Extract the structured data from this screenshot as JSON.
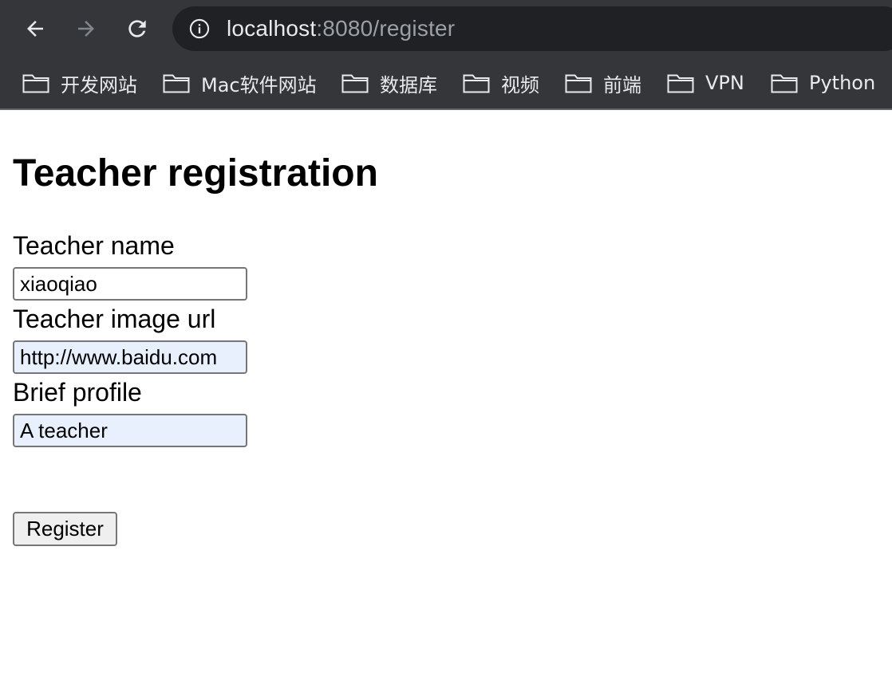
{
  "browser": {
    "url_host": "localhost",
    "url_rest": ":8080/register",
    "bookmarks": [
      {
        "label": "开发网站"
      },
      {
        "label": "Mac软件网站"
      },
      {
        "label": "数据库"
      },
      {
        "label": "视频"
      },
      {
        "label": "前端"
      },
      {
        "label": "VPN"
      },
      {
        "label": "Python"
      }
    ],
    "colors": {
      "toolbar": "#35363a",
      "omnibox": "#202124",
      "text": "#e8eaed",
      "muted": "#9aa0a6"
    }
  },
  "page": {
    "title": "Teacher registration",
    "form": {
      "name_label": "Teacher name",
      "name_value": "xiaoqiao",
      "image_label": "Teacher image url",
      "image_value": "http://www.baidu.com",
      "profile_label": "Brief profile",
      "profile_value": "A teacher",
      "submit_label": "Register"
    }
  }
}
